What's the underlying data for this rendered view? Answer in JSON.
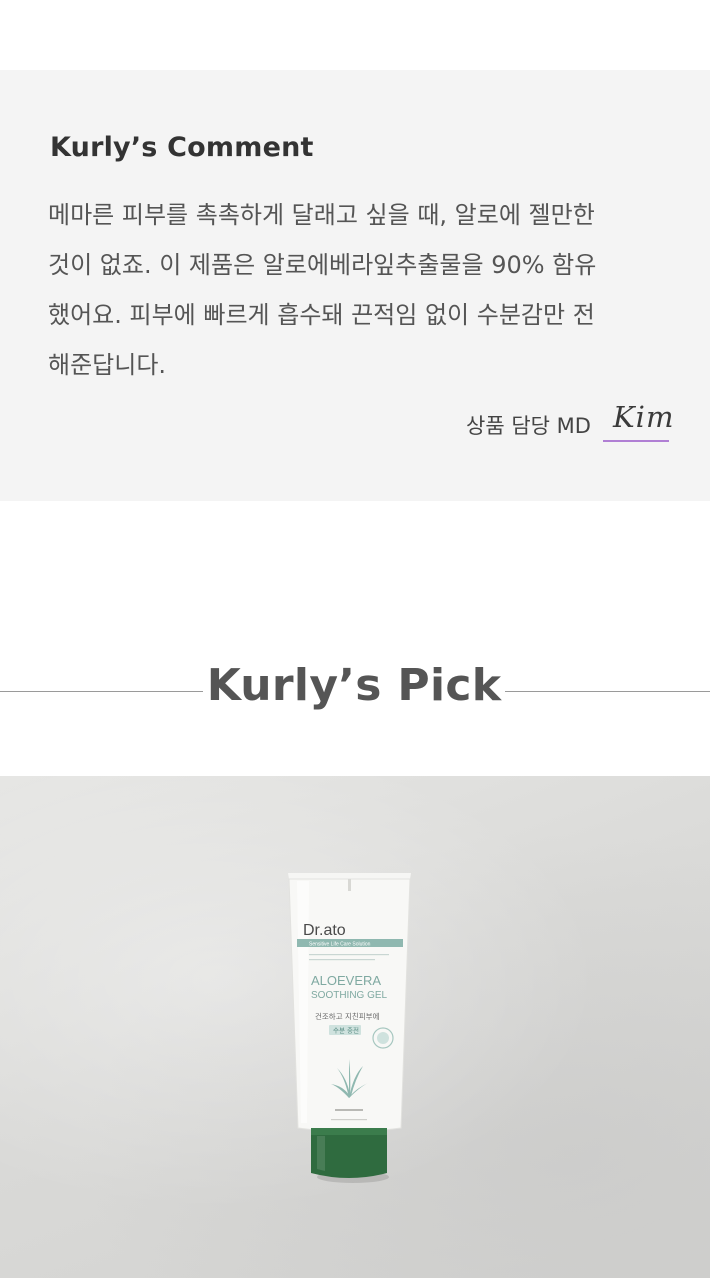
{
  "comment": {
    "heading": "Kurly’s Comment",
    "lines": [
      "메마른 피부를 촉촉하게 달래고 싶을 때, 알로에 젤만한",
      "것이 없죠. 이 제품은 알로에베라잎추출물을 90% 함유",
      "했어요. 피부에 빠르게 흡수돼 끈적임 없이 수분감만 전",
      "해준답니다."
    ],
    "md_label": "상품 담당 MD",
    "md_signature": "Kim"
  },
  "pick": {
    "title": "Kurly’s Pick"
  },
  "product": {
    "brand": "Dr.ato",
    "line": "Sensitive Life Care Solution",
    "name_line1": "ALOEVERA",
    "name_line2": "SOOTHING GEL",
    "korean_line1": "건조하고 지친피부에",
    "korean_line2": "수분 충전"
  },
  "colors": {
    "background": "#ffffff",
    "comment_box": "#f4f4f4",
    "signature_underline": "#b07fd4",
    "tube_cap": "#2f6b3f",
    "tube_accent": "#8fb8b0"
  }
}
